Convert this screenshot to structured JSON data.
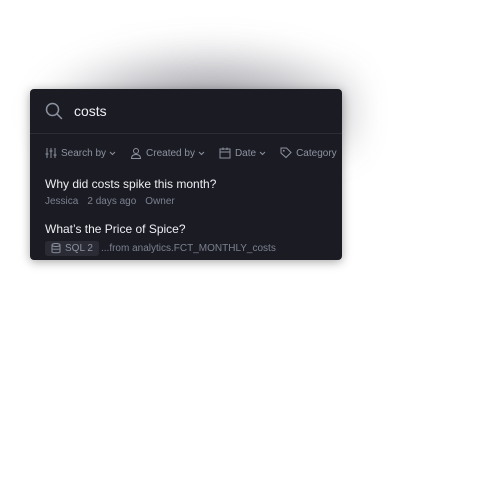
{
  "search": {
    "value": "costs"
  },
  "filters": [
    {
      "label": "Search by",
      "icon": "sliders-icon"
    },
    {
      "label": "Created by",
      "icon": "person-icon"
    },
    {
      "label": "Date",
      "icon": "calendar-icon"
    },
    {
      "label": "Category",
      "icon": "tag-icon"
    }
  ],
  "results": [
    {
      "title": "Why did costs spike this month?",
      "author": "Jessica",
      "time": "2 days ago",
      "role": "Owner"
    },
    {
      "title": "What’s the Price of Spice?",
      "badge": "SQL 2",
      "snippet": "...from analytics.FCT_MONTHLY_costs"
    }
  ],
  "colors": {
    "panel_bg": "#1b1c23",
    "text_primary": "#eceef3",
    "text_muted": "#8d92a0"
  }
}
